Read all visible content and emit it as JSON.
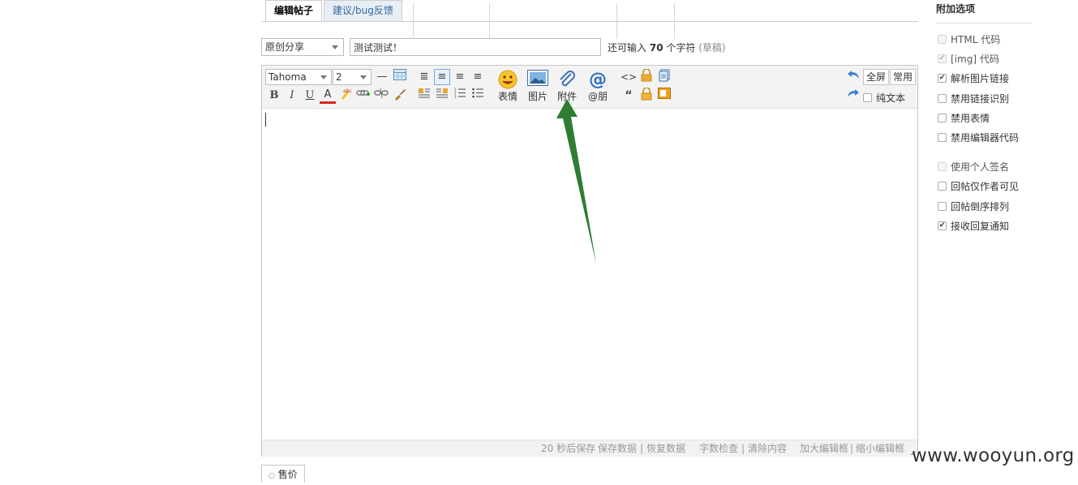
{
  "tabs": [
    {
      "label": "编辑帖子",
      "active": true
    },
    {
      "label": "建议/bug反馈",
      "active": false
    }
  ],
  "post_type": {
    "selected": "原创分享"
  },
  "title_input": {
    "value": "测试测试！"
  },
  "remaining": {
    "prefix": "还可输入",
    "count": "70",
    "suffix": "个字符",
    "draft": "(草稿)"
  },
  "toolbar": {
    "font": "Tahoma",
    "size": "2",
    "bold": "B",
    "italic": "I",
    "underline": "U",
    "font_color": "A",
    "emoji_label": "表情",
    "image_label": "图片",
    "attach_label": "附件",
    "at_label": "@朋",
    "fullscreen": "全屏",
    "common": "常用",
    "plain_text": "纯文本"
  },
  "statusbar": {
    "autosave": "20 秒后保存",
    "save_data": "保存数据",
    "restore": "恢复数据",
    "word_check": "字数检查",
    "clear": "清除内容",
    "enlarge": "加大编辑框",
    "shrink": "缩小编辑框",
    "separator": "|"
  },
  "bottom_tab": {
    "label": "售价"
  },
  "sidebar": {
    "title": "附加选项",
    "options": [
      {
        "label": "HTML 代码",
        "checked": false,
        "disabled": true
      },
      {
        "label": "[img] 代码",
        "checked": true,
        "disabled": true
      },
      {
        "label": "解析图片链接",
        "checked": true,
        "disabled": false
      },
      {
        "label": "禁用链接识别",
        "checked": false,
        "disabled": false
      },
      {
        "label": "禁用表情",
        "checked": false,
        "disabled": false
      },
      {
        "label": "禁用编辑器代码",
        "checked": false,
        "disabled": false
      },
      {
        "label": "使用个人签名",
        "checked": false,
        "disabled": true
      },
      {
        "label": "回帖仅作者可见",
        "checked": false,
        "disabled": false
      },
      {
        "label": "回帖倒序排列",
        "checked": false,
        "disabled": false
      },
      {
        "label": "接收回复通知",
        "checked": true,
        "disabled": false
      }
    ]
  },
  "watermark": "www.wooyun.org",
  "colors": {
    "arrow": "#2e7d32",
    "tab_bg": "#e8eef6",
    "link": "#336699"
  }
}
